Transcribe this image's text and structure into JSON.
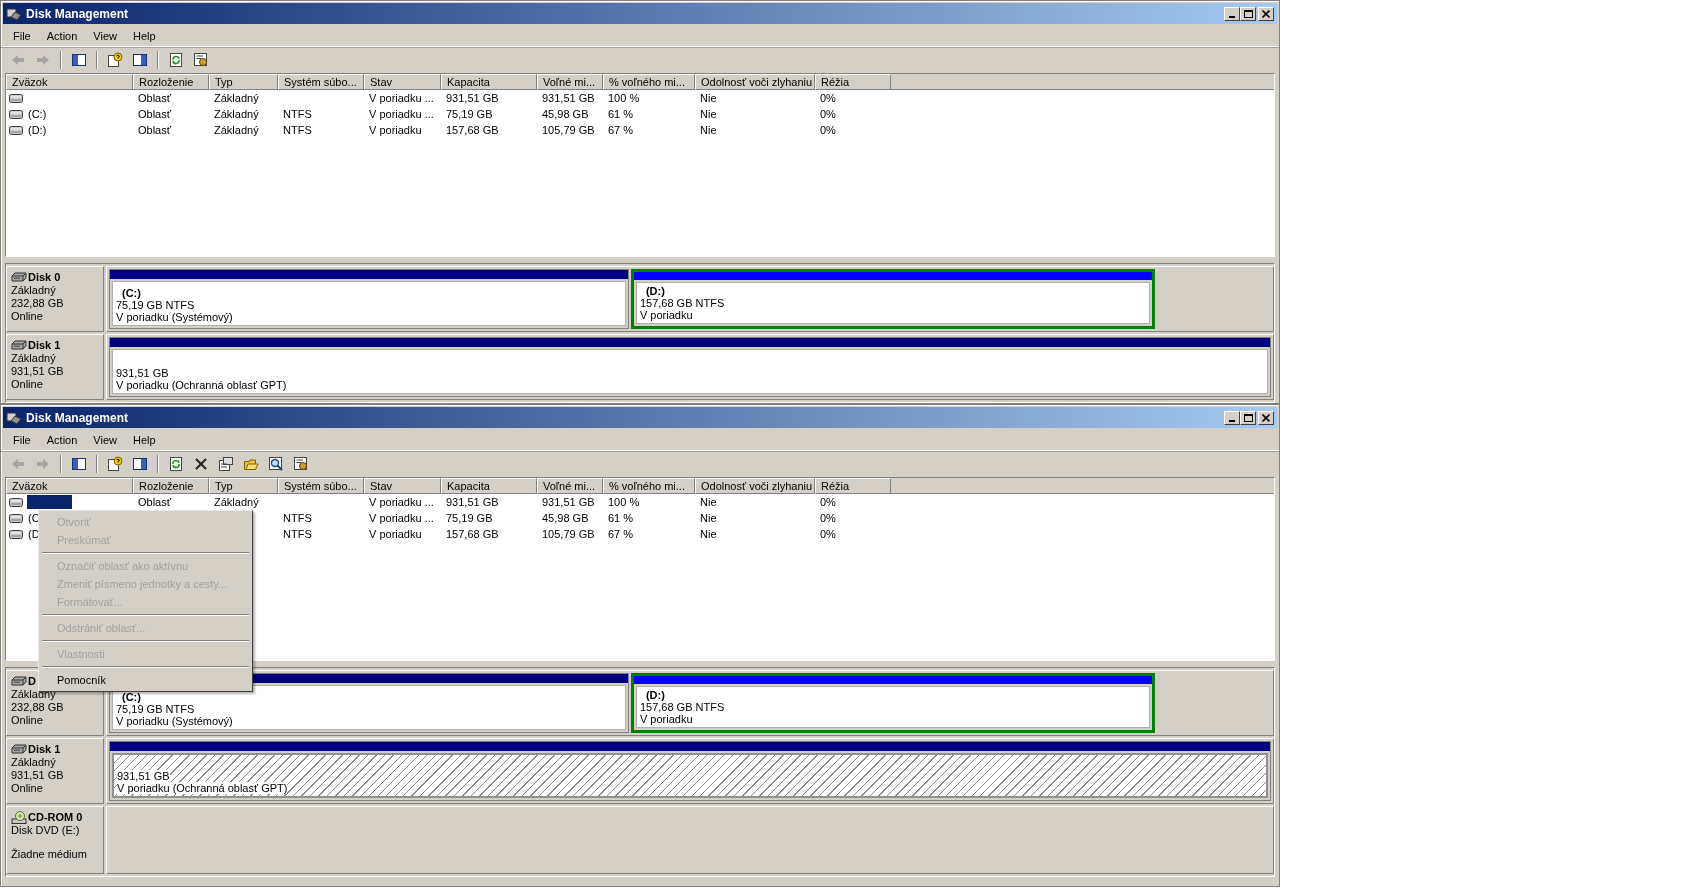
{
  "windows": [
    {
      "title": "Disk Management",
      "menu": [
        "File",
        "Action",
        "View",
        "Help"
      ],
      "toolbar": [
        {
          "kind": "back",
          "disabled": true
        },
        {
          "kind": "forward",
          "disabled": true
        },
        {
          "kind": "separator"
        },
        {
          "kind": "panel",
          "disabled": false
        },
        {
          "kind": "separator"
        },
        {
          "kind": "help",
          "disabled": false
        },
        {
          "kind": "panel-right",
          "disabled": false
        },
        {
          "kind": "separator"
        },
        {
          "kind": "refresh",
          "disabled": false
        },
        {
          "kind": "settings",
          "disabled": false
        }
      ],
      "volumes": {
        "columns": [
          "Zväzok",
          "Rozloženie",
          "Typ",
          "Systém súbo...",
          "Stav",
          "Kapacita",
          "Voľné mi...",
          "% voľného mi...",
          "Odolnosť voči zlyhaniu",
          "Réžia"
        ],
        "rows": [
          {
            "selected": false,
            "cells": [
              "",
              "Oblasť",
              "Základný",
              "",
              "V poriadku ...",
              "931,51 GB",
              "931,51 GB",
              "100 %",
              "Nie",
              "0%"
            ]
          },
          {
            "selected": false,
            "cells": [
              "(C:)",
              "Oblasť",
              "Základný",
              "NTFS",
              "V poriadku ...",
              "75,19 GB",
              "45,98 GB",
              "61 %",
              "Nie",
              "0%"
            ]
          },
          {
            "selected": false,
            "cells": [
              "(D:)",
              "Oblasť",
              "Základný",
              "NTFS",
              "V poriadku",
              "157,68 GB",
              "105,79 GB",
              "67 %",
              "Nie",
              "0%"
            ]
          }
        ]
      },
      "disks": [
        {
          "kind": "disk",
          "name": "Disk 0",
          "lines": [
            "Základný",
            "232,88 GB"
          ],
          "status": "Online",
          "partitions": [
            {
              "kind": "primary",
              "selected": false,
              "label": "(C:)",
              "size": "75,19 GB NTFS",
              "state": "V poriadku (Systémový)"
            },
            {
              "kind": "logical",
              "selected": false,
              "label": "(D:)",
              "size": "157,68 GB NTFS",
              "state": "V poriadku"
            }
          ]
        },
        {
          "kind": "disk",
          "name": "Disk 1",
          "lines": [
            "Základný",
            "931,51 GB"
          ],
          "status": "Online",
          "partitions": [
            {
              "kind": "primary",
              "selected": false,
              "size": "931,51 GB",
              "state": "V poriadku (Ochranná oblasť GPT)"
            }
          ]
        }
      ]
    },
    {
      "title": "Disk Management",
      "menu": [
        "File",
        "Action",
        "View",
        "Help"
      ],
      "toolbar": [
        {
          "kind": "back",
          "disabled": true
        },
        {
          "kind": "forward",
          "disabled": true
        },
        {
          "kind": "separator"
        },
        {
          "kind": "panel",
          "disabled": false
        },
        {
          "kind": "separator"
        },
        {
          "kind": "help",
          "disabled": false
        },
        {
          "kind": "panel-right",
          "disabled": false
        },
        {
          "kind": "separator"
        },
        {
          "kind": "refresh",
          "disabled": false
        },
        {
          "kind": "delete",
          "disabled": false
        },
        {
          "kind": "properties",
          "disabled": false
        },
        {
          "kind": "open",
          "disabled": false
        },
        {
          "kind": "search",
          "disabled": false
        },
        {
          "kind": "settings",
          "disabled": false
        }
      ],
      "volumes": {
        "columns": [
          "Zväzok",
          "Rozloženie",
          "Typ",
          "Systém súbo...",
          "Stav",
          "Kapacita",
          "Voľné mi...",
          "% voľného mi...",
          "Odolnosť voči zlyhaniu",
          "Réžia"
        ],
        "rows": [
          {
            "selected": true,
            "cells": [
              "",
              "Oblasť",
              "Základný",
              "",
              "V poriadku ...",
              "931,51 GB",
              "931,51 GB",
              "100 %",
              "Nie",
              "0%"
            ]
          },
          {
            "selected": false,
            "cells": [
              "(C",
              null,
              null,
              "NTFS",
              "V poriadku ...",
              "75,19 GB",
              "45,98 GB",
              "61 %",
              "Nie",
              "0%"
            ]
          },
          {
            "selected": false,
            "cells": [
              "(D",
              null,
              null,
              "NTFS",
              "V poriadku",
              "157,68 GB",
              "105,79 GB",
              "67 %",
              "Nie",
              "0%"
            ]
          }
        ]
      },
      "context_menu": [
        {
          "kind": "item",
          "label": "Otvoriť",
          "disabled": true
        },
        {
          "kind": "item",
          "label": "Preskúmať",
          "disabled": true
        },
        {
          "kind": "separator"
        },
        {
          "kind": "item",
          "label": "Označiť oblasť ako aktívnu",
          "disabled": true
        },
        {
          "kind": "item",
          "label": "Zmeniť písmeno jednotky a cesty...",
          "disabled": true
        },
        {
          "kind": "item",
          "label": "Formátovať...",
          "disabled": true
        },
        {
          "kind": "separator"
        },
        {
          "kind": "item",
          "label": "Odstrániť oblasť...",
          "disabled": true
        },
        {
          "kind": "separator"
        },
        {
          "kind": "item",
          "label": "Vlastnosti",
          "disabled": true
        },
        {
          "kind": "separator"
        },
        {
          "kind": "item",
          "label": "Pomocník",
          "disabled": false
        }
      ],
      "disks": [
        {
          "kind": "disk",
          "name": "D",
          "lines": [
            "Základný",
            "232,88 GB"
          ],
          "status": "Online",
          "partitions": [
            {
              "kind": "primary",
              "selected": false,
              "label": "(C:)",
              "size": "75,19 GB NTFS",
              "state": "V poriadku (Systémový)"
            },
            {
              "kind": "logical",
              "selected": false,
              "label": "(D:)",
              "size": "157,68 GB NTFS",
              "state": "V poriadku"
            }
          ]
        },
        {
          "kind": "disk",
          "name": "Disk 1",
          "lines": [
            "Základný",
            "931,51 GB"
          ],
          "status": "Online",
          "partitions": [
            {
              "kind": "primary",
              "selected": true,
              "size": "931,51 GB",
              "state": "V poriadku (Ochranná oblasť GPT)"
            }
          ]
        },
        {
          "kind": "cdrom",
          "name": "CD-ROM 0",
          "lines": [
            "Disk DVD (E:)"
          ],
          "status": "Žiadne médium"
        }
      ]
    }
  ]
}
